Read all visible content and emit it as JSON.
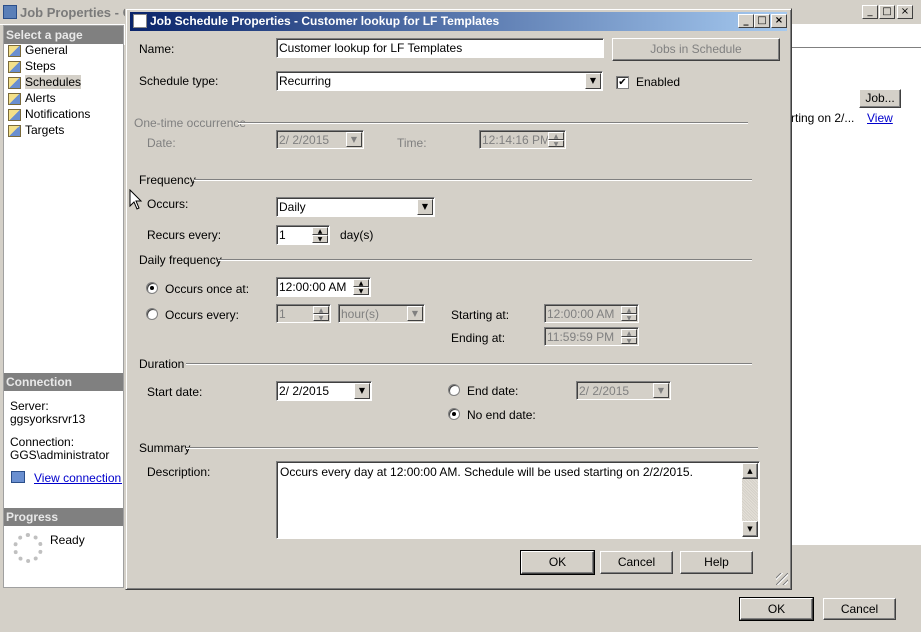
{
  "bg_window": {
    "title": "Job Properties - C",
    "select_page_header": "Select a page",
    "pages": [
      "General",
      "Steps",
      "Schedules",
      "Alerts",
      "Notifications",
      "Targets"
    ],
    "selected_page": "Schedules",
    "connection_header": "Connection",
    "server_label": "Server:",
    "server_value": "ggsyorksrvr13",
    "connection_label": "Connection:",
    "connection_value": "GGS\\administrator",
    "view_connection_link": "View connection pr",
    "progress_header": "Progress",
    "progress_status": "Ready",
    "jobs_column": "Job...",
    "row_partial_text": "rting on 2/...",
    "row_view_link": "View",
    "ok_label": "OK",
    "cancel_label": "Cancel"
  },
  "dialog": {
    "title": "Job Schedule Properties - Customer lookup for LF Templates",
    "name_label": "Name:",
    "name_value": "Customer lookup for LF Templates",
    "jobs_in_schedule_label": "Jobs in Schedule",
    "schedule_type_label": "Schedule type:",
    "schedule_type_value": "Recurring",
    "enabled_label": "Enabled",
    "one_time": {
      "header": "One-time occurrence",
      "date_label": "Date:",
      "date_value": "2/  2/2015",
      "time_label": "Time:",
      "time_value": "12:14:16 PM"
    },
    "frequency": {
      "header": "Frequency",
      "occurs_label": "Occurs:",
      "occurs_value": "Daily",
      "recurs_every_label": "Recurs every:",
      "recurs_every_value": "1",
      "recurs_unit": "day(s)"
    },
    "daily_frequency": {
      "header": "Daily frequency",
      "occurs_once_label": "Occurs once at:",
      "occurs_once_value": "12:00:00 AM",
      "occurs_every_label": "Occurs every:",
      "occurs_every_value": "1",
      "occurs_every_unit": "hour(s)",
      "starting_at_label": "Starting at:",
      "starting_at_value": "12:00:00 AM",
      "ending_at_label": "Ending at:",
      "ending_at_value": "11:59:59 PM"
    },
    "duration": {
      "header": "Duration",
      "start_date_label": "Start date:",
      "start_date_value": "2/  2/2015",
      "end_date_label": "End date:",
      "end_date_value": "2/  2/2015",
      "no_end_date_label": "No end date:"
    },
    "summary": {
      "header": "Summary",
      "description_label": "Description:",
      "description_value": "Occurs every day at 12:00:00 AM. Schedule will be used starting on 2/2/2015."
    },
    "ok_label": "OK",
    "cancel_label": "Cancel",
    "help_label": "Help"
  }
}
